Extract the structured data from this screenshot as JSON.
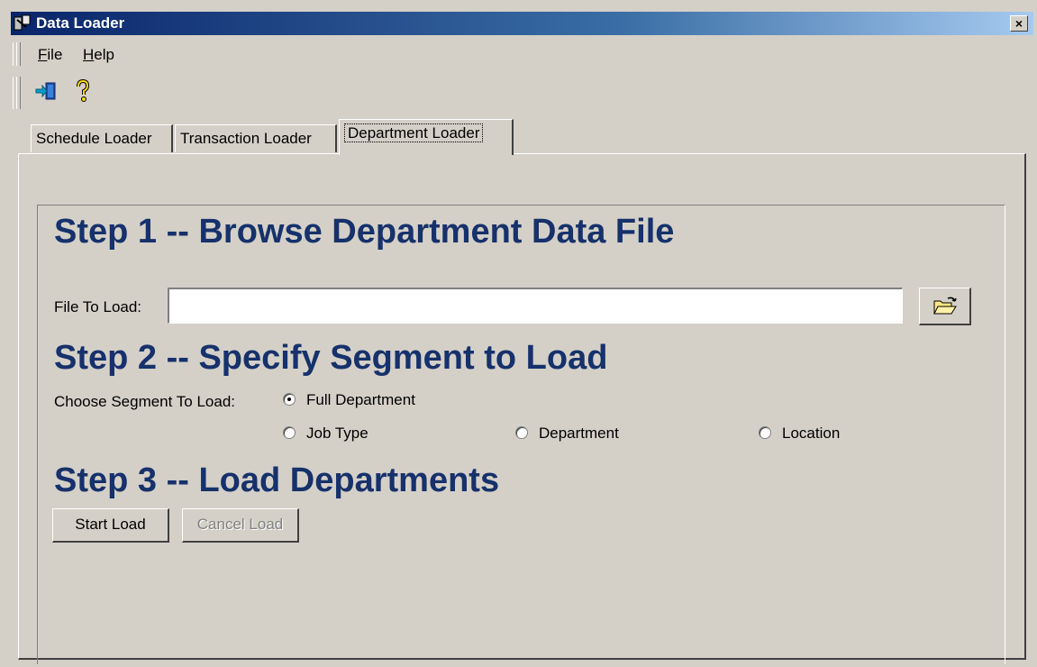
{
  "window": {
    "title": "Data Loader",
    "close_glyph": "×"
  },
  "menu": {
    "file": {
      "mnemonic": "F",
      "rest": "ile"
    },
    "help": {
      "mnemonic": "H",
      "rest": "elp"
    }
  },
  "toolbar": {
    "icons": [
      "exit-icon",
      "help-icon"
    ]
  },
  "tabs": [
    "Schedule Loader",
    "Transaction Loader",
    "Department Loader"
  ],
  "active_tab": "Department Loader",
  "step1": {
    "title": "Step 1 -- Browse Department Data File",
    "file_label": "File To Load:",
    "file_value": ""
  },
  "step2": {
    "title": "Step 2 -- Specify Segment to Load",
    "choose_label": "Choose Segment To Load:",
    "options": [
      "Full Department",
      "Job Type",
      "Department",
      "Location"
    ],
    "selected": "Full Department"
  },
  "step3": {
    "title": "Step 3 -- Load Departments",
    "start_label": "Start Load",
    "cancel_label": "Cancel Load"
  },
  "colors": {
    "heading": "#16316b",
    "face": "#d4d0c8",
    "title_bar": "#0a246a"
  }
}
